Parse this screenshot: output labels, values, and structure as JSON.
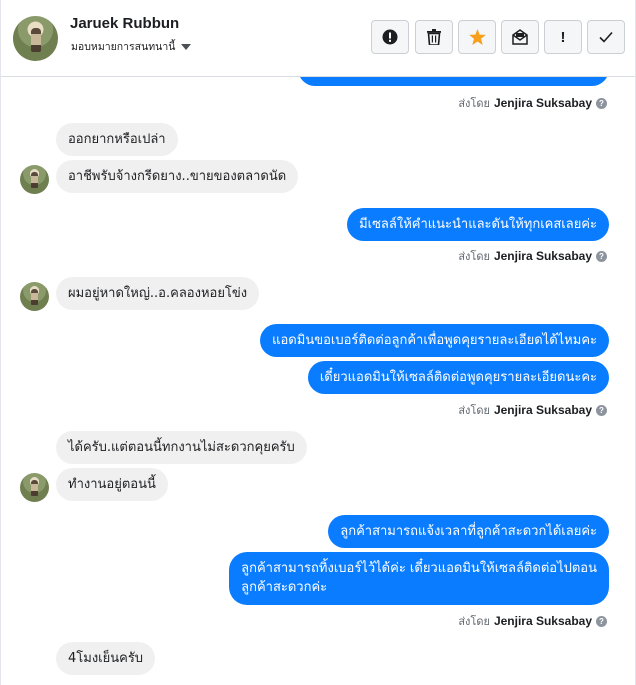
{
  "header": {
    "user_name": "Jaruek Rubbun",
    "assign_label": "มอบหมายการสนทนานี้",
    "buttons": [
      {
        "name": "spam",
        "icon": "alert-circle-icon"
      },
      {
        "name": "delete",
        "icon": "trash-icon"
      },
      {
        "name": "star",
        "icon": "star-icon",
        "color": "#f79e1b"
      },
      {
        "name": "mark-unread",
        "icon": "envelope-icon"
      },
      {
        "name": "follow-up",
        "label": "!"
      },
      {
        "name": "done",
        "icon": "check-icon"
      }
    ]
  },
  "colors": {
    "outgoing": "#0a7cff",
    "incoming": "#f1f0f0",
    "star": "#f79e1b"
  },
  "conversation": {
    "sent_by_prefix": "ส่งโดย",
    "agent_name": "Jenjira Suksabay",
    "messages": {
      "m1": "ออกยากหรือเปล่า",
      "m2": "อาชีพรับจ้างกรีดยาง..ขายของตลาดนัด",
      "m3": "มีเซลล์ให้คำแนะนำและดันให้ทุกเคสเลยค่ะ",
      "m4": "ผมอยู่หาดใหญ่..อ.คลองหอยโข่ง",
      "m5": "แอดมินขอเบอร์ติดต่อลูกค้าเพื่อพูดคุยรายละเอียดได้ไหมคะ",
      "m6": "เดี๋ยวแอดมินให้เซลล์ติดต่อพูดคุยรายละเอียดนะคะ",
      "m7": "ได้ครับ.แต่ตอนนี้ทกงานไม่สะดวกคุยครับ",
      "m8": "ทำงานอยู่ตอนนี้",
      "m9": "ลูกค้าสามารถแจ้งเวลาที่ลูกค้าสะดวกได้เลยค่ะ",
      "m10_line1": "ลูกค้าสามารถทิ้งเบอร์ไว้ได้ค่ะ เดี๋ยวแอดมินให้เซลล์ติดต่อไปตอน",
      "m10_line2": "ลูกค้าสะดวกค่ะ",
      "m11": "4โมงเย็นครับ"
    }
  }
}
